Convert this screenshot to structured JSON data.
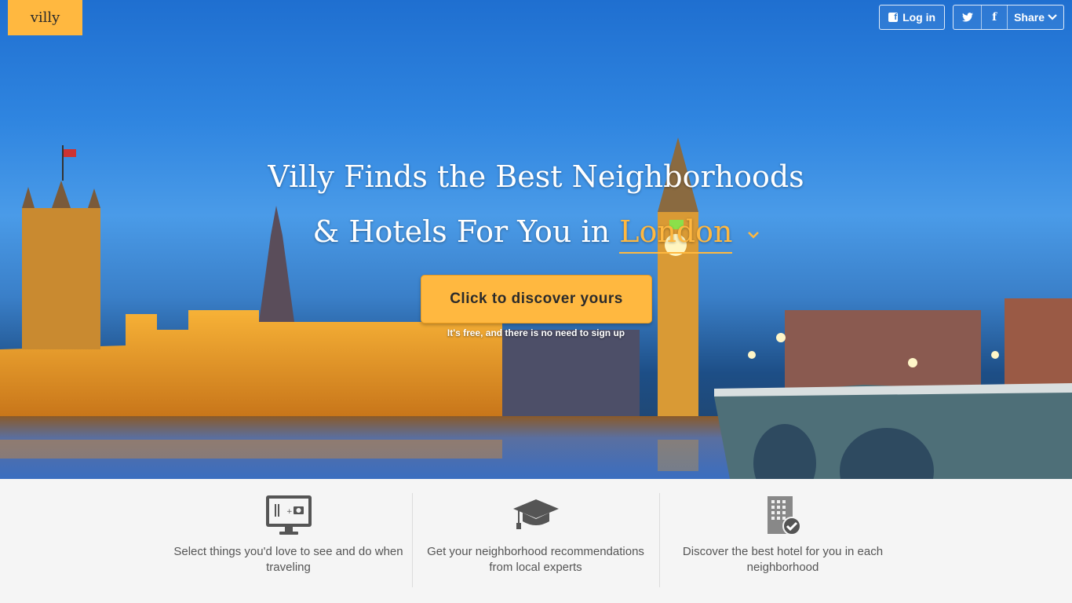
{
  "logo": {
    "text": "villy"
  },
  "header": {
    "login_label": "Log in",
    "facebook_glyph": "f",
    "share_label": "Share"
  },
  "hero": {
    "headline_line1": "Villy Finds the Best Neighborhoods",
    "headline_line2_prefix": "& Hotels For You in",
    "city": "London",
    "cta_label": "Click to discover yours",
    "cta_subtext": "It's free, and there is no need to sign up"
  },
  "features": [
    {
      "icon": "monitor-icon",
      "text": "Select things you'd love to see and do when traveling"
    },
    {
      "icon": "graduation-cap-icon",
      "text": "Get your neighborhood recommendations from local experts"
    },
    {
      "icon": "hotel-check-icon",
      "text": "Discover the best hotel for you in each neighborhood"
    }
  ],
  "colors": {
    "accent": "#ffb840",
    "sky": "#3f93e4",
    "feature_text": "#555555",
    "feature_bg": "#f5f5f5"
  }
}
